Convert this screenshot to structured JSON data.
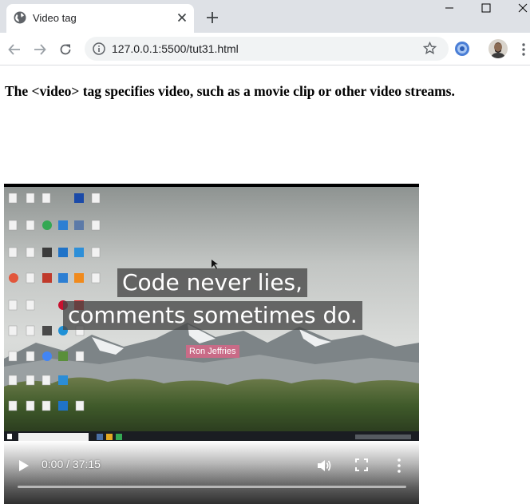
{
  "browser": {
    "tab_title": "Video tag",
    "url": "127.0.0.1:5500/tut31.html"
  },
  "page": {
    "heading": "The <video> tag specifies video, such as a movie clip or other video streams."
  },
  "video": {
    "quote_line_1": "Code never lies,",
    "quote_line_2": "comments sometimes do.",
    "author": "Ron Jeffries",
    "time_display": "0:00 / 37:15",
    "progress": 0
  }
}
